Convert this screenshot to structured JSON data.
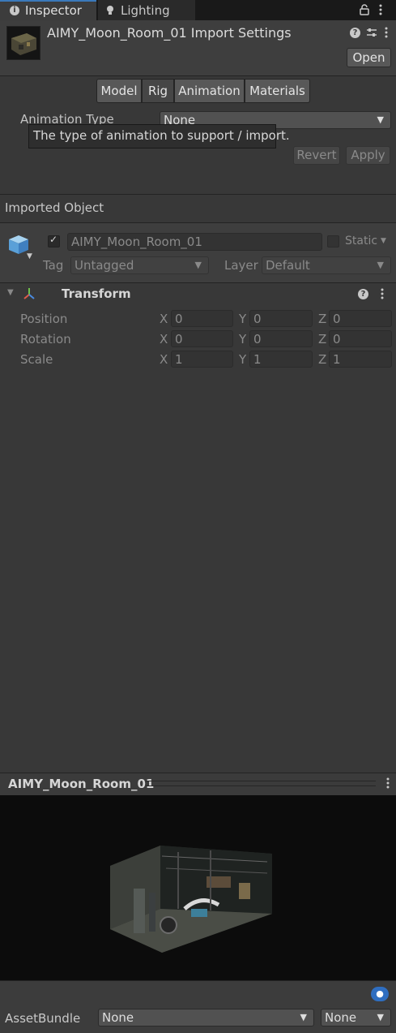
{
  "tabs": {
    "inspector": "Inspector",
    "lighting": "Lighting",
    "lock_icon": "lock-icon",
    "menu_icon": "kebab-menu-icon"
  },
  "header": {
    "title": "AIMY_Moon_Room_01 Import Settings",
    "open_label": "Open",
    "help_icon": "help-icon",
    "settings_icon": "preset-icon"
  },
  "import_tabs": [
    "Model",
    "Rig",
    "Animation",
    "Materials"
  ],
  "rig": {
    "animation_type_label": "Animation Type",
    "animation_type_value": "None",
    "tooltip": "The type of animation to support / import.",
    "revert_label": "Revert",
    "apply_label": "Apply"
  },
  "imported_object": {
    "section_title": "Imported Object",
    "name": "AIMY_Moon_Room_01",
    "static_label": "Static",
    "tag_label": "Tag",
    "tag_value": "Untagged",
    "layer_label": "Layer",
    "layer_value": "Default"
  },
  "transform": {
    "title": "Transform",
    "rows": [
      {
        "label": "Position",
        "x": "0",
        "y": "0",
        "z": "0"
      },
      {
        "label": "Rotation",
        "x": "0",
        "y": "0",
        "z": "0"
      },
      {
        "label": "Scale",
        "x": "1",
        "y": "1",
        "z": "1"
      }
    ],
    "axis_x": "X",
    "axis_y": "Y",
    "axis_z": "Z"
  },
  "preview": {
    "title": "AIMY_Moon_Room_01"
  },
  "asset_bundle": {
    "label": "AssetBundle",
    "name_value": "None",
    "variant_value": "None"
  },
  "colors": {
    "accent": "#3a79bb",
    "panel": "#383838",
    "preview_bg": "#0c0c0c"
  }
}
